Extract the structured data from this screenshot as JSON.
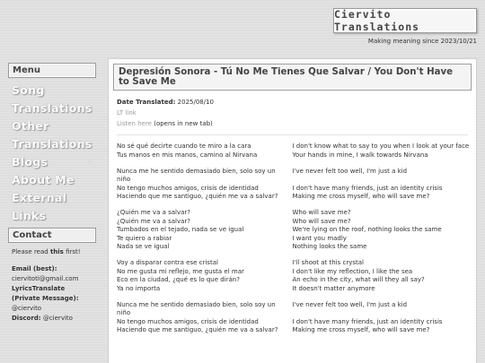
{
  "site": {
    "logo": "Ciervito Translations",
    "tagline": "Making meaning since 2023/10/21"
  },
  "sidebar": {
    "menu_heading": "Menu",
    "items": [
      {
        "label": "Song Translations"
      },
      {
        "label": "Other Translations"
      },
      {
        "label": "Blogs",
        "chevron": "›"
      },
      {
        "label": "About Me"
      },
      {
        "label": "External Links"
      }
    ],
    "contact_heading": "Contact",
    "contact": {
      "intro_prefix": "Please read ",
      "intro_bold": "this",
      "intro_suffix": " first!",
      "email_label": "Email (best):",
      "email": "ciervitoti@gmail.com",
      "lt_label_1": "LyricsTranslate",
      "lt_label_2": "(Private Message):",
      "lt_user": "@ciervito",
      "discord_label": "Discord:",
      "discord_user": " @ciervito"
    }
  },
  "main": {
    "title": "Depresión Sonora - Tú No Me Tienes Que Salvar / You Don't Have to Save Me",
    "date_label": "Date Translated:",
    "date_value": " 2025/08/10",
    "lt_link": "LT link",
    "listen_link": "Listen here",
    "listen_note": " (opens in new tab)"
  },
  "lyrics": [
    [
      [
        "No sé qué decirte cuando te miro a la cara",
        "I don't know what to say to you when I look at your face"
      ],
      [
        "Tus manos en mis manos, camino al Nirvana",
        "Your hands in mine, I walk towards Nirvana"
      ]
    ],
    [
      [
        "Nunca me he sentido demasiado bien, solo soy un niño",
        "I've never felt too well, I'm just a kid"
      ],
      [
        "No tengo muchos amigos, crisis de identidad",
        "I don't have many friends, just an identity crisis"
      ],
      [
        "Haciendo que me santiguo, ¿quién me va a salvar?",
        "Making me cross myself, who will save me?"
      ]
    ],
    [
      [
        "¿Quién me va a salvar?",
        "Who will save me?"
      ],
      [
        "¿Quién me va a salvar?",
        "Who will save me?"
      ],
      [
        "Tumbados en el tejado, nada se ve igual",
        "We're lying on the roof, nothing looks the same"
      ],
      [
        "Te quiero a rabiar",
        "I want you madly"
      ],
      [
        "Nada se ve igual",
        "Nothing looks the same"
      ]
    ],
    [
      [
        "Voy a disparar contra ese cristal",
        "I'll shoot at this crystal"
      ],
      [
        "No me gusta mi reflejo, me gusta el mar",
        "I don't like my reflection, I like the sea"
      ],
      [
        "Eco en la ciudad, ¿qué es lo que dirán?",
        "An echo in the city, what will they all say?"
      ],
      [
        "Ya no importa",
        "It doesn't matter anymore"
      ]
    ],
    [
      [
        "Nunca me he sentido demasiado bien, solo soy un niño",
        "I've never felt too well, I'm just a kid"
      ],
      [
        "No tengo muchos amigos, crisis de identidad",
        "I don't have many friends, just an identity crisis"
      ],
      [
        "Haciendo que me santiguo, ¿quién me va a salvar?",
        "Making me cross myself, who will save me?"
      ]
    ]
  ]
}
